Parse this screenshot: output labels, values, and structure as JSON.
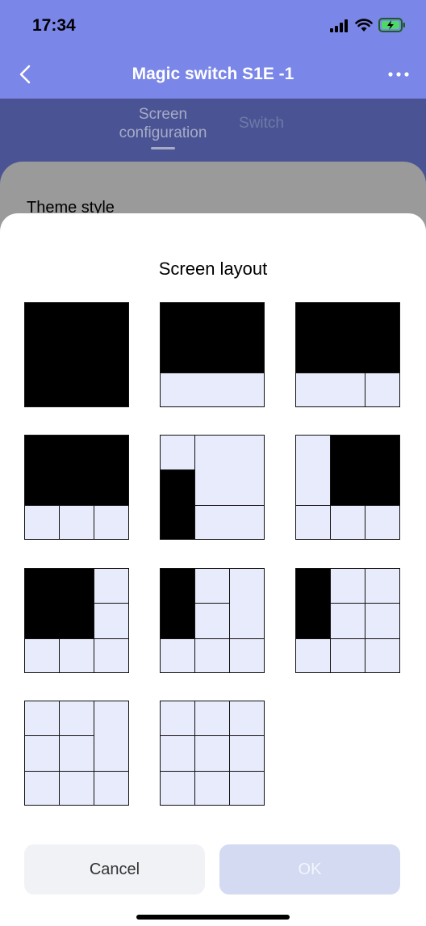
{
  "status_bar": {
    "time": "17:34",
    "signal_icon": "signal-icon",
    "wifi_icon": "wifi-icon",
    "battery_icon": "battery-charging-icon"
  },
  "header": {
    "title": "Magic switch S1E -1",
    "back_icon": "chevron-left-icon",
    "more_icon": "more-dots-icon"
  },
  "tabs": [
    {
      "label": "Screen configuration",
      "active": true
    },
    {
      "label": "Switch",
      "active": false
    }
  ],
  "background_card": {
    "label": "Theme style"
  },
  "sheet": {
    "title": "Screen layout",
    "cancel_label": "Cancel",
    "ok_label": "OK",
    "layouts": [
      {
        "id": "layout-1",
        "filled": "one full block"
      },
      {
        "id": "layout-2",
        "filled": "top block, one bottom cell"
      },
      {
        "id": "layout-3",
        "filled": "top block, two bottom cells"
      },
      {
        "id": "layout-4",
        "filled": "top block, three bottom cells"
      },
      {
        "id": "layout-5",
        "filled": "left tall block"
      },
      {
        "id": "layout-6",
        "filled": "top-right block"
      },
      {
        "id": "layout-7",
        "filled": "top-left block"
      },
      {
        "id": "layout-8",
        "filled": "left block, grid right"
      },
      {
        "id": "layout-9",
        "filled": "left block, 3x3 grid"
      },
      {
        "id": "layout-10",
        "filled": "none, right tall cell"
      },
      {
        "id": "layout-11",
        "filled": "none, 3x3 grid"
      }
    ]
  },
  "colors": {
    "header_bg": "#7a86e8",
    "dim_bg": "#4a5494",
    "cell_bg": "#e8ebfb",
    "selected_cell": "#000000",
    "ok_disabled": "#d3daf1"
  }
}
